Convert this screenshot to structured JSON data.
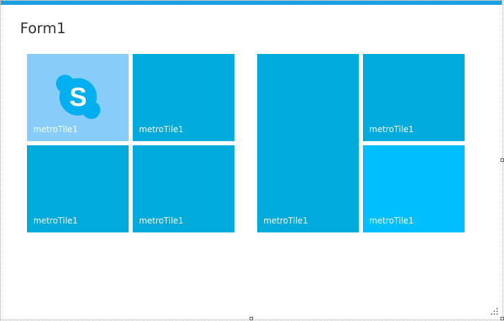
{
  "form": {
    "title": "Form1"
  },
  "colors": {
    "accent": "#1ba1e2",
    "tile_default": "#00aadb",
    "tile_light": "#87cdfb",
    "tile_bright": "#00bfff"
  },
  "tiles": [
    {
      "label": "metroTile1",
      "icon": "skype-icon",
      "style": "light"
    },
    {
      "label": "metroTile1",
      "style": "default"
    },
    {
      "label": "metroTile1",
      "style": "default"
    },
    {
      "label": "metroTile1",
      "style": "default"
    },
    {
      "label": "metroTile1",
      "style": "default"
    },
    {
      "label": "metroTile1",
      "style": "default"
    },
    {
      "label": "metroTile1",
      "style": "bright"
    }
  ]
}
